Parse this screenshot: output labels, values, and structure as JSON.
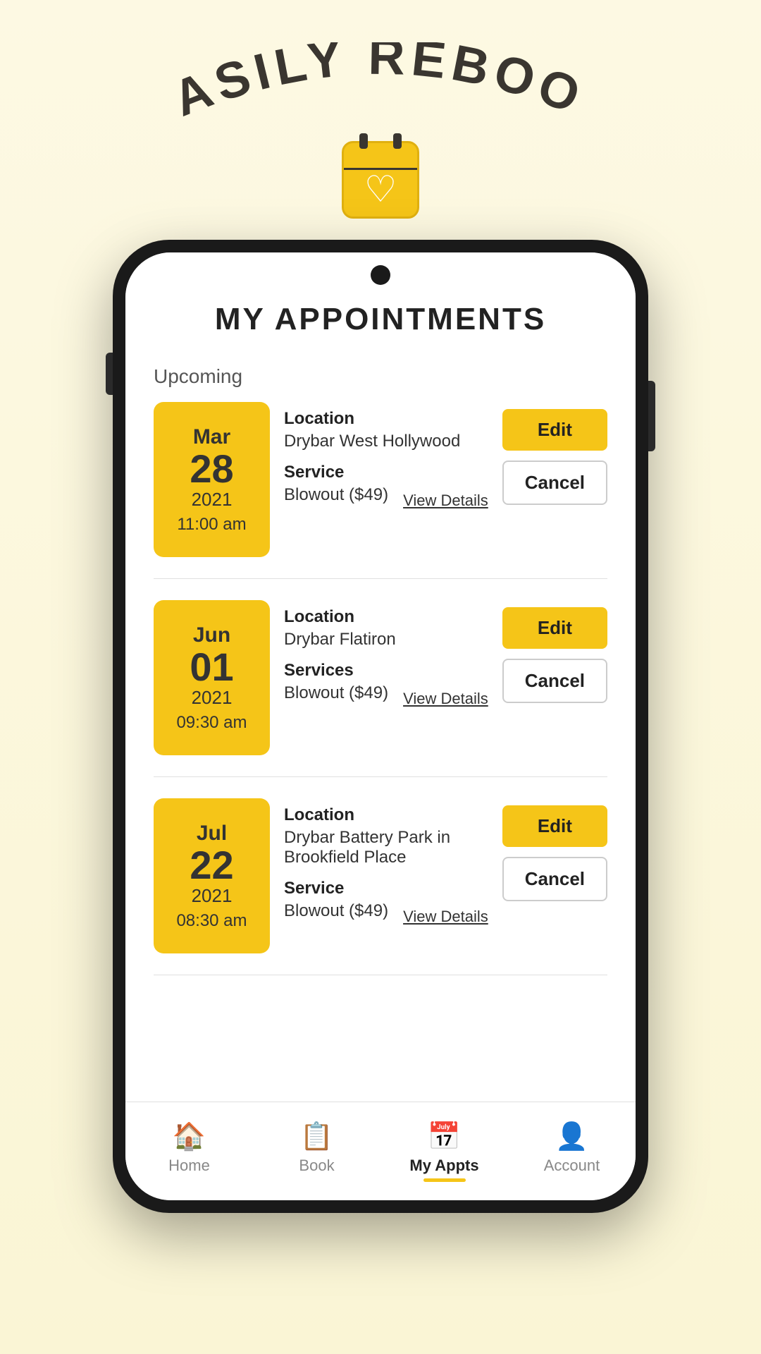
{
  "hero": {
    "title": "EASILY REBOOK",
    "calendar_icon_alt": "calendar-heart-icon"
  },
  "page": {
    "title": "MY APPOINTMENTS",
    "section_upcoming": "Upcoming"
  },
  "appointments": [
    {
      "month": "Mar",
      "day": "28",
      "year": "2021",
      "time": "11:00 am",
      "location_label": "Location",
      "location": "Drybar West Hollywood",
      "service_label": "Service",
      "service": "Blowout ($49)",
      "edit_label": "Edit",
      "cancel_label": "Cancel",
      "view_details_label": "View Details"
    },
    {
      "month": "Jun",
      "day": "01",
      "year": "2021",
      "time": "09:30 am",
      "location_label": "Location",
      "location": "Drybar Flatiron",
      "service_label": "Services",
      "service": "Blowout ($49)",
      "edit_label": "Edit",
      "cancel_label": "Cancel",
      "view_details_label": "View Details"
    },
    {
      "month": "Jul",
      "day": "22",
      "year": "2021",
      "time": "08:30 am",
      "location_label": "Location",
      "location": "Drybar Battery Park in Brookfield Place",
      "service_label": "Service",
      "service": "Blowout ($49)",
      "edit_label": "Edit",
      "cancel_label": "Cancel",
      "view_details_label": "View Details"
    }
  ],
  "nav": {
    "items": [
      {
        "label": "Home",
        "icon": "🏠"
      },
      {
        "label": "Book",
        "icon": "📋"
      },
      {
        "label": "My Appts",
        "icon": "📅",
        "active": true
      },
      {
        "label": "Account",
        "icon": "👤"
      }
    ]
  }
}
